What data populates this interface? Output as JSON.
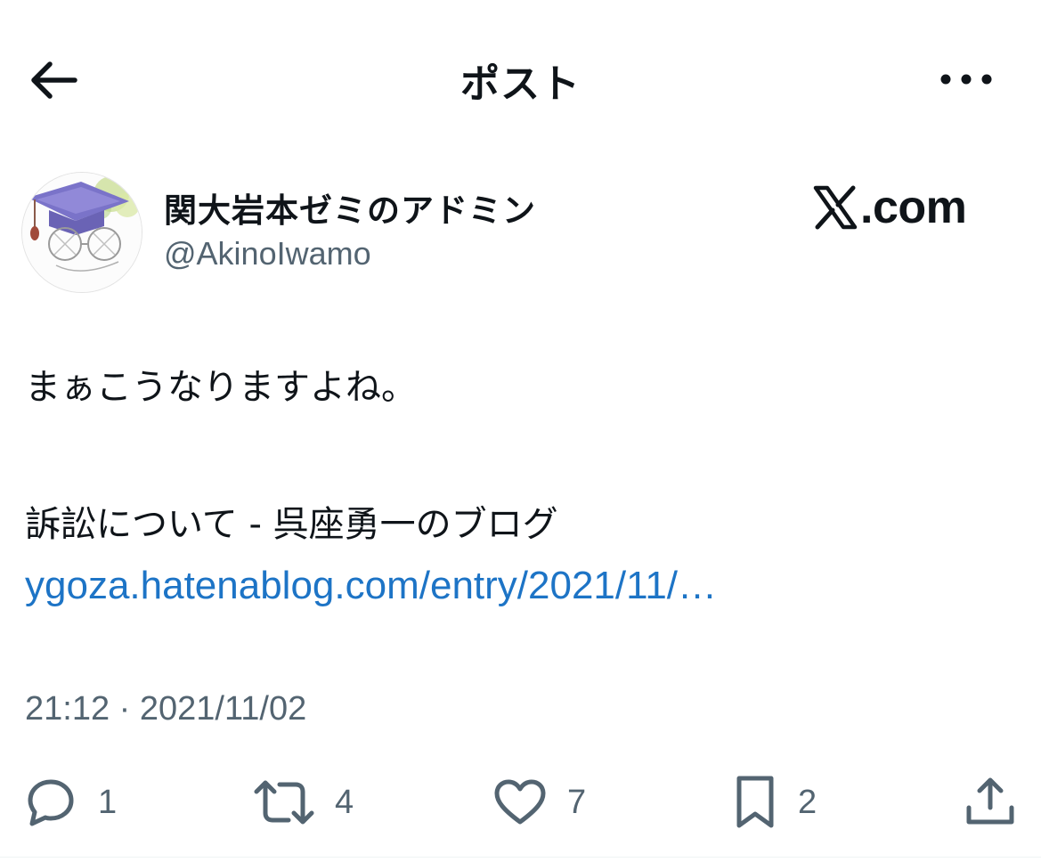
{
  "header": {
    "title": "ポスト",
    "back_icon": "arrow-left-icon",
    "more_icon": "ellipsis-icon"
  },
  "author": {
    "display_name": "関大岩本ゼミのアドミン",
    "handle": "@AkinoIwamo"
  },
  "brand": {
    "text": ".com"
  },
  "post": {
    "text_line1": "まぁこうなりますよね。",
    "text_line2": "訴訟について - 呉座勇一のブログ",
    "link_text": "ygoza.hatenablog.com/entry/2021/11/…",
    "timestamp": "21:12 · 2021/11/02"
  },
  "actions": {
    "reply_count": "1",
    "repost_count": "4",
    "like_count": "7",
    "bookmark_count": "2"
  },
  "colors": {
    "text": "#0f1419",
    "secondary": "#536471",
    "link": "#1d74c6"
  }
}
